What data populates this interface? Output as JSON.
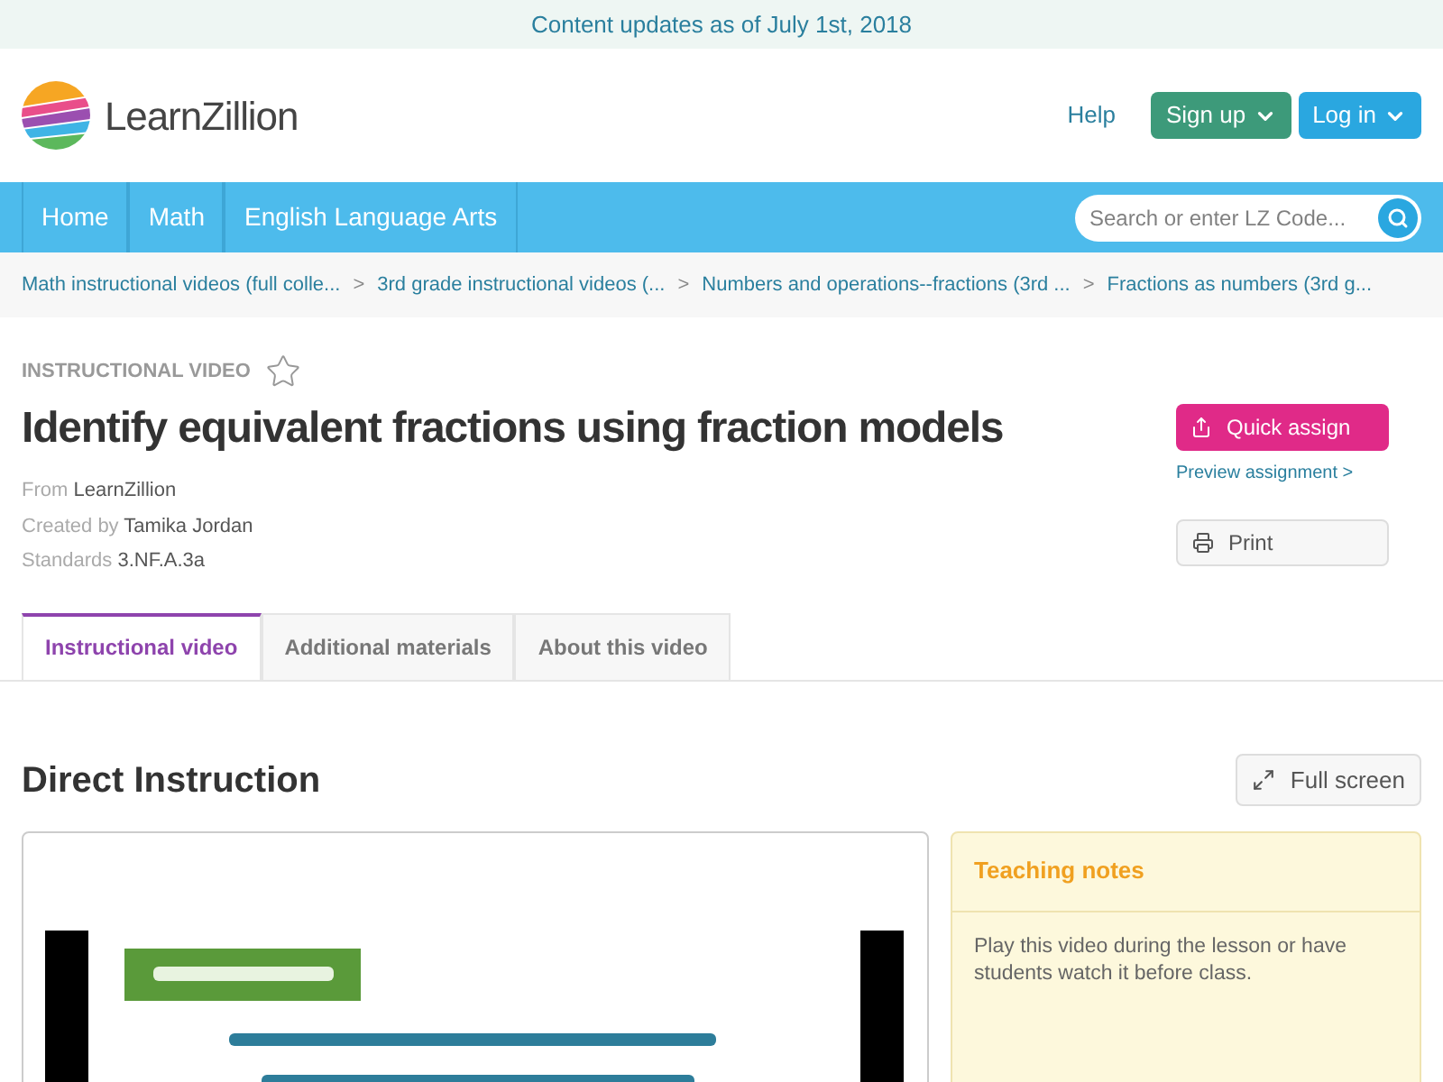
{
  "banner": {
    "text": "Content updates as of July 1st, 2018"
  },
  "header": {
    "logo_text": "LearnZillion",
    "help": "Help",
    "signup": "Sign up",
    "login": "Log in"
  },
  "nav": {
    "items": [
      {
        "label": "Home"
      },
      {
        "label": "Math"
      },
      {
        "label": "English Language Arts"
      }
    ],
    "search": {
      "placeholder": "Search or enter LZ Code..."
    }
  },
  "breadcrumbs": [
    {
      "label": "Math instructional videos (full colle..."
    },
    {
      "separator": ">",
      "label": "3rd grade instructional videos (..."
    },
    {
      "separator": ">",
      "label": "Numbers and operations--fractions (3rd ..."
    },
    {
      "separator": ">",
      "label": "Fractions as numbers (3rd g..."
    }
  ],
  "lesson": {
    "type": "INSTRUCTIONAL VIDEO",
    "favorited": false,
    "title": "Identify equivalent fractions using fraction models",
    "meta": [
      {
        "label": "From",
        "value": "LearnZillion"
      },
      {
        "label": "Created by",
        "value": "Tamika Jordan"
      },
      {
        "label": "Standards",
        "value": "3.NF.A.3a"
      }
    ],
    "quick_assign": "Quick assign",
    "preview": "Preview assignment >",
    "print": "Print"
  },
  "tabs": [
    {
      "label": "Instructional video",
      "selected": true
    },
    {
      "label": "Additional materials",
      "selected": false
    },
    {
      "label": "About this video",
      "selected": false
    }
  ],
  "section": {
    "title": "Direct Instruction",
    "fullscreen": "Full screen"
  },
  "teaching_notes": {
    "title": "Teaching notes",
    "text": "Play this video during the lesson or have students watch it before class."
  }
}
